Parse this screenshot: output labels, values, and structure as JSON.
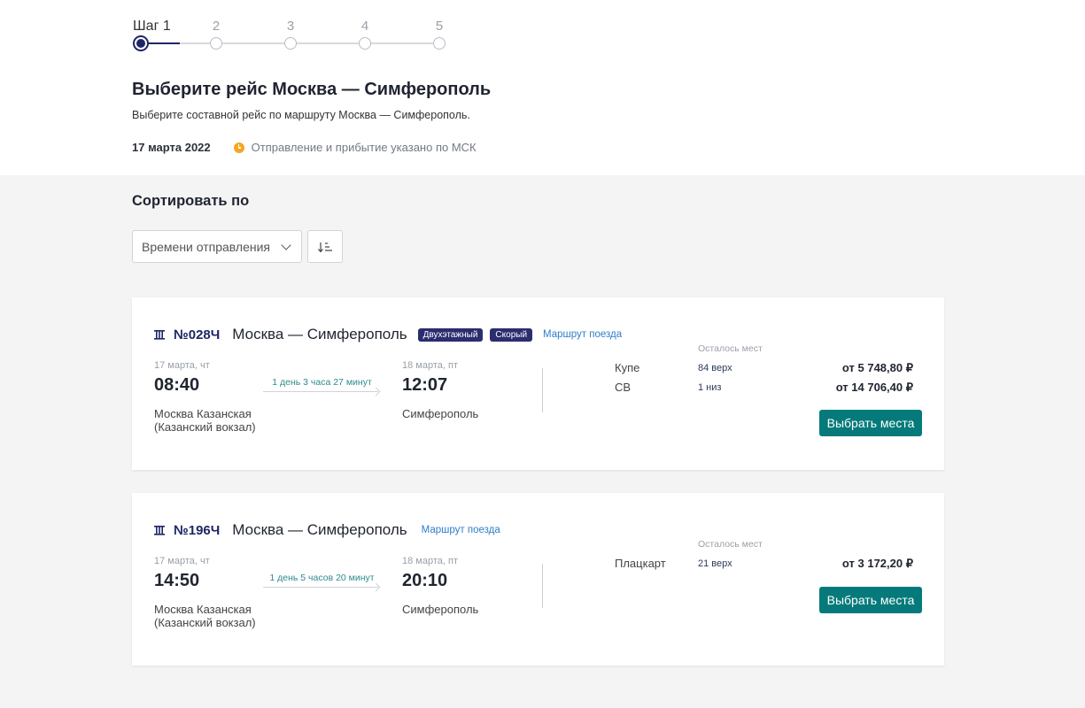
{
  "stepper": {
    "steps": [
      {
        "label": "Шаг 1",
        "active": true
      },
      {
        "label": "2",
        "active": false
      },
      {
        "label": "3",
        "active": false
      },
      {
        "label": "4",
        "active": false
      },
      {
        "label": "5",
        "active": false
      }
    ]
  },
  "header": {
    "title": "Выберите рейс Москва — Симферополь",
    "subtitle": "Выберите составной рейс по маршруту Москва — Симферополь.",
    "date": "17 марта 2022",
    "tz_note": "Отправление и прибытие указано по МСК"
  },
  "sort": {
    "title": "Сортировать по",
    "selected": "Времени отправления"
  },
  "trains": [
    {
      "number": "№028Ч",
      "route": "Москва — Симферополь",
      "badges": [
        "Двухэтажный",
        "Скорый"
      ],
      "route_link": "Маршрут поезда",
      "dep_date": "17 марта, чт",
      "dep_time": "08:40",
      "dep_station": "Москва Казанская (Казанский вокзал)",
      "duration": "1 день 3 часа 27 минут",
      "arr_date": "18 марта, пт",
      "arr_time": "12:07",
      "arr_station": "Симферополь",
      "seats_head": "Осталось мест",
      "classes": [
        {
          "name": "Купе",
          "seats": "84 верх",
          "price": "от 5 748,80 ₽"
        },
        {
          "name": "СВ",
          "seats": "1 низ",
          "price": "от 14 706,40 ₽"
        }
      ],
      "button": "Выбрать места"
    },
    {
      "number": "№196Ч",
      "route": "Москва — Симферополь",
      "badges": [],
      "route_link": "Маршрут поезда",
      "dep_date": "17 марта, чт",
      "dep_time": "14:50",
      "dep_station": "Москва Казанская (Казанский вокзал)",
      "duration": "1 день 5 часов 20 минут",
      "arr_date": "18 марта, пт",
      "arr_time": "20:10",
      "arr_station": "Симферополь",
      "seats_head": "Осталось мест",
      "classes": [
        {
          "name": "Плацкарт",
          "seats": "21 верх",
          "price": "от 3 172,20 ₽"
        }
      ],
      "button": "Выбрать места"
    }
  ],
  "colors": {
    "brand_navy": "#1f2666",
    "accent_teal": "#067a7a",
    "link_blue": "#2f7ec9",
    "clock_orange": "#f5a623"
  }
}
